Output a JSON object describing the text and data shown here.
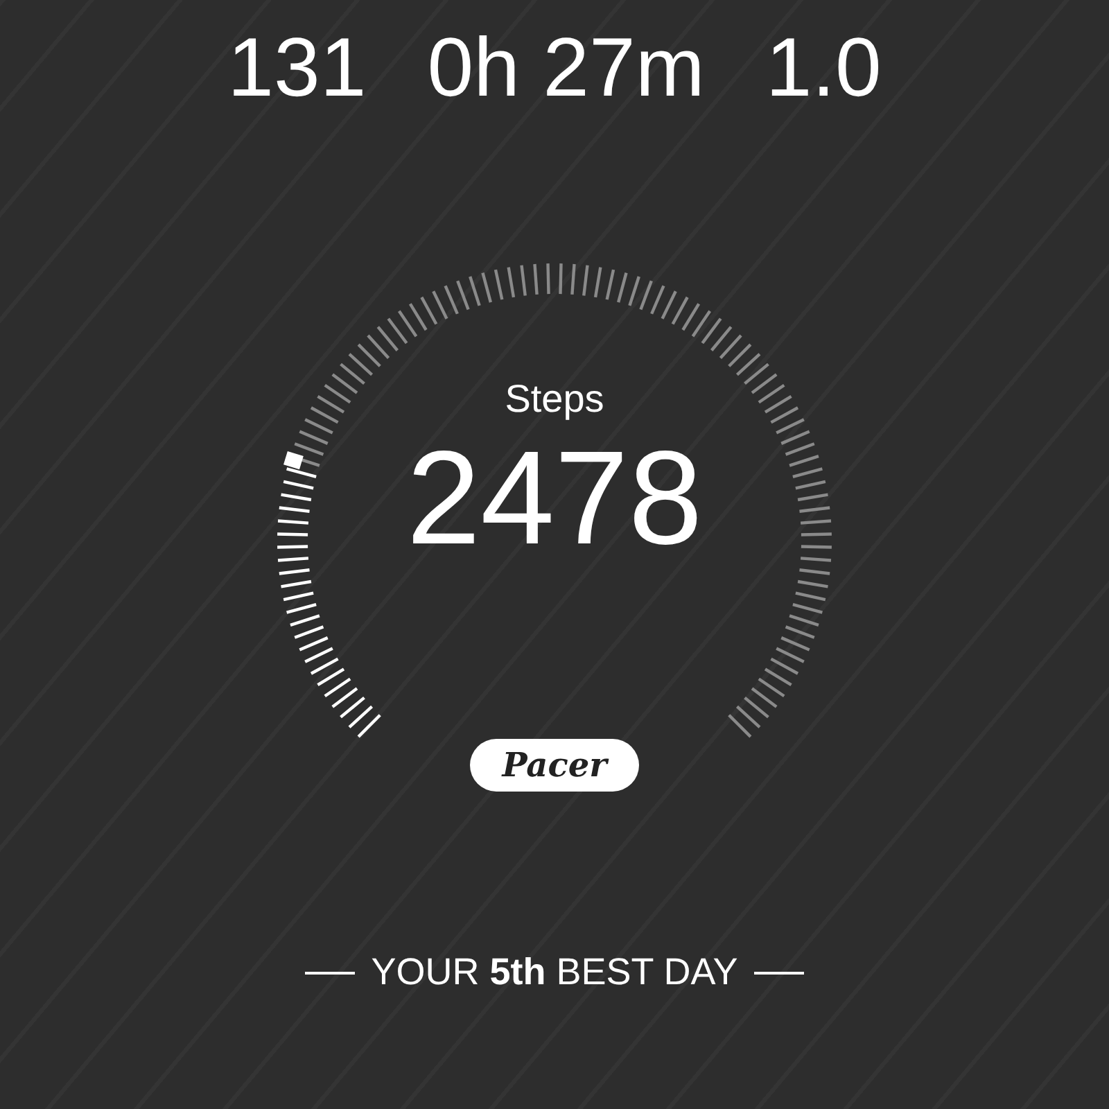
{
  "stats": [
    {
      "value": "131"
    },
    {
      "value": "0h 27m"
    },
    {
      "value": "1.0"
    }
  ],
  "gauge": {
    "label": "Steps",
    "value": "2478"
  },
  "badge": {
    "text": "Pacer"
  },
  "footer": {
    "text": "YOUR **5th** BEST DAY"
  }
}
